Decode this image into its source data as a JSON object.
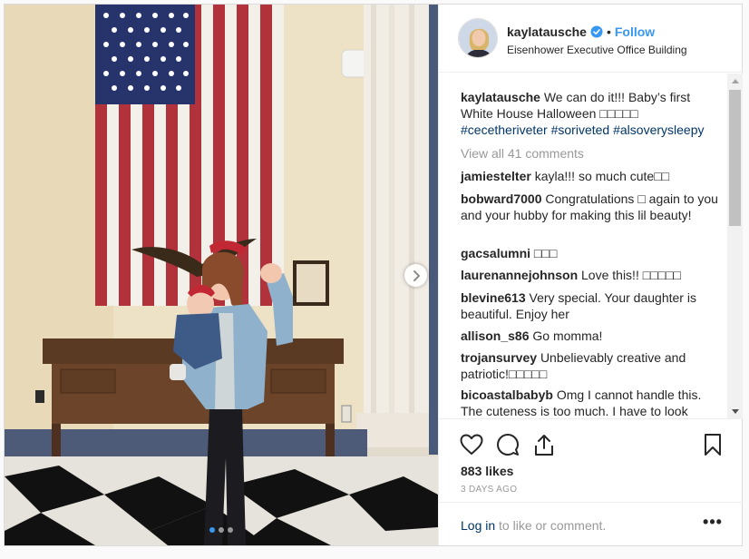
{
  "post": {
    "username": "kaylatausche",
    "follow_label": "Follow",
    "bullet": "•",
    "location": "Eisenhower Executive Office Building"
  },
  "caption": {
    "username": "kaylatausche",
    "text": "We can do it!!! Baby’s first White House Halloween",
    "emoji": "□□□□□",
    "hashtags": [
      "#cecetheriveter",
      "#soriveted",
      "#alsoverysleepy"
    ]
  },
  "view_all_comments": "View all 41 comments",
  "comments": [
    {
      "username": "jamiestelter",
      "text": "kayla!!! so much cute□□"
    },
    {
      "username": "bobward7000",
      "text": "Congratulations □ again to you and your hubby for making this lil beauty!"
    },
    {
      "username": "gacsalumni",
      "text": "□□□"
    },
    {
      "username": "laurenannejohnson",
      "text": "Love this!! □□□□□"
    },
    {
      "username": "blevine613",
      "text": "Very special. Your daughter is beautiful. Enjoy her"
    },
    {
      "username": "allison_s86",
      "text": "Go momma!"
    },
    {
      "username": "trojansurvey",
      "text": "Unbelievably creative and patriotic!□□□□□"
    },
    {
      "username": "bicoastalbabyb",
      "text": "Omg I cannot handle this. The cuteness is too much. I have to look"
    }
  ],
  "likes": "883 likes",
  "age": "3 DAYS AGO",
  "footer": {
    "login_link": "Log in",
    "login_rest": " to like or comment.",
    "more_label": "•••"
  },
  "carousel": {
    "total": 3,
    "current": 1
  },
  "colors": {
    "accent": "#3897f0",
    "link": "#003569",
    "muted": "#999999",
    "text": "#262626"
  },
  "icons": [
    "heart-icon",
    "comment-icon",
    "share-icon",
    "bookmark-icon",
    "verified-badge-icon",
    "chevron-right-icon",
    "more-options-icon"
  ]
}
